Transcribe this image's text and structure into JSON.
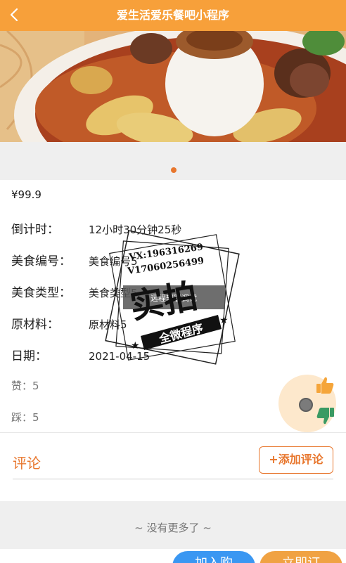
{
  "nav": {
    "title": "爱生活爱乐餐吧小程序",
    "back_icon": "chevron-left-icon"
  },
  "colors": {
    "nav_bg": "#f7a03a",
    "accent": "#e8772e",
    "cart_btn": "#3a97f2",
    "buy_btn": "#f0a243"
  },
  "product": {
    "price": "¥99.9",
    "fields": [
      {
        "label": "倒计时：",
        "value": "12小时30分钟25秒"
      },
      {
        "label": "美食编号：",
        "value": "美食编号5"
      },
      {
        "label": "美食类型：",
        "value": "美食类型5"
      },
      {
        "label": "原材料：",
        "value": "原材料5"
      },
      {
        "label": "日期：",
        "value": "2021-04-15"
      }
    ],
    "likes": "赞：5",
    "dislikes": "踩：5"
  },
  "comments": {
    "title": "评论",
    "add_label": "+添加评论"
  },
  "footer": {
    "no_more": "~ 没有更多了 ~"
  },
  "actions": {
    "cart_label": "加入购",
    "buy_label": "立即订"
  },
  "watermark": {
    "line1": "VX:196316269",
    "line2": "V17060256499",
    "big": "实拍",
    "ribbon": "全微程序",
    "strip": "远程部署调试"
  }
}
